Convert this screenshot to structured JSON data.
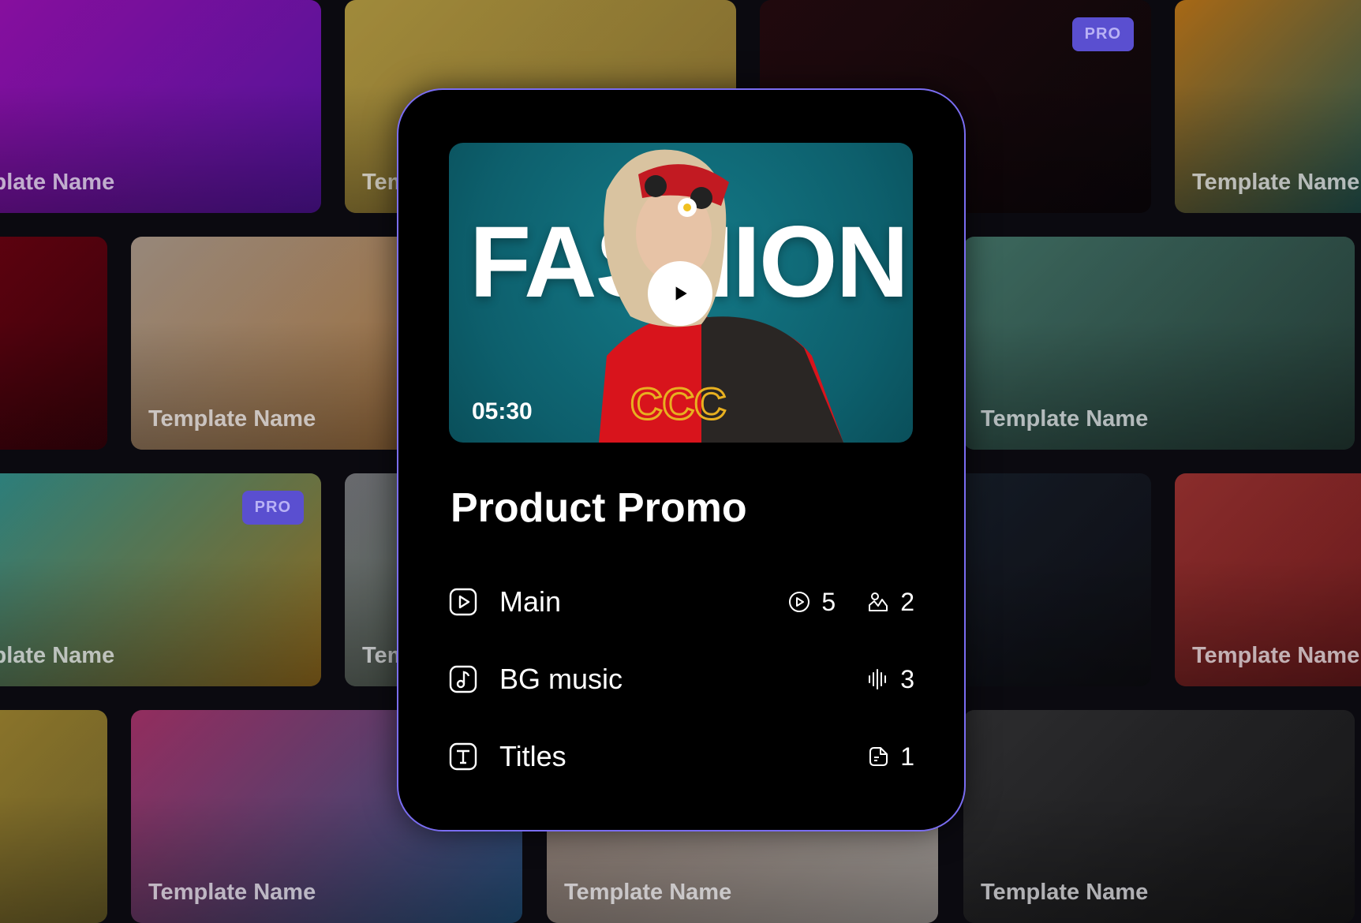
{
  "tiles": [
    {
      "label": "Template Name",
      "pro": false,
      "c1": "#b312d0",
      "c2": "#6a18c8"
    },
    {
      "label": "Template Name",
      "pro": false,
      "c1": "#d6b84a",
      "c2": "#a88a38"
    },
    {
      "label": "Template Name",
      "pro": true,
      "c1": "#2a0a0e",
      "c2": "#0c0608"
    },
    {
      "label": "Template Name",
      "pro": false,
      "c1": "#e08a18",
      "c2": "#2a6a62"
    },
    {
      "label": "Template Name",
      "pro": false,
      "c1": "#7a0010",
      "c2": "#4a0008"
    },
    {
      "label": "Template Name",
      "pro": false,
      "c1": "#c9b4a0",
      "c2": "#d28a3a"
    },
    {
      "label": "Template Name",
      "pro": false,
      "c1": "#3a3a3a",
      "c2": "#202020"
    },
    {
      "label": "Template Name",
      "pro": false,
      "c1": "#4f8a7a",
      "c2": "#2c4a40"
    },
    {
      "label": "Template Name",
      "pro": true,
      "c1": "#3aa8a0",
      "c2": "#c08a20"
    },
    {
      "label": "Template Name",
      "pro": false,
      "c1": "#8a8c90",
      "c2": "#5a7a50"
    },
    {
      "label": "Template Name",
      "pro": false,
      "c1": "#1e2a3a",
      "c2": "#101014"
    },
    {
      "label": "Template Name",
      "pro": false,
      "c1": "#b83a36",
      "c2": "#8a2020"
    },
    {
      "label": "Template Name",
      "pro": false,
      "c1": "#b89a34",
      "c2": "#8a7a30"
    },
    {
      "label": "Template Name",
      "pro": false,
      "c1": "#c43a7a",
      "c2": "#2a6aa0"
    },
    {
      "label": "Template Name",
      "pro": false,
      "c1": "#b8a090",
      "c2": "#d8d0c8"
    },
    {
      "label": "Template Name",
      "pro": false,
      "c1": "#3a3a3a",
      "c2": "#1a1a1a"
    }
  ],
  "pro_label": "PRO",
  "card": {
    "video": {
      "headline": "FASHION",
      "duration": "05:30",
      "play_icon": "play-icon"
    },
    "title": "Product Promo",
    "border_color": "#7a6df2",
    "rows": [
      {
        "name": "Main",
        "icon": "video-square-icon",
        "stats": [
          {
            "icon": "play-circle-icon",
            "value": "5"
          },
          {
            "icon": "image-icon",
            "value": "2"
          }
        ]
      },
      {
        "name": "BG music",
        "icon": "music-note-icon",
        "stats": [
          {
            "icon": "waveform-icon",
            "value": "3"
          }
        ]
      },
      {
        "name": "Titles",
        "icon": "text-t-icon",
        "stats": [
          {
            "icon": "sticker-icon",
            "value": "1"
          }
        ]
      }
    ]
  }
}
